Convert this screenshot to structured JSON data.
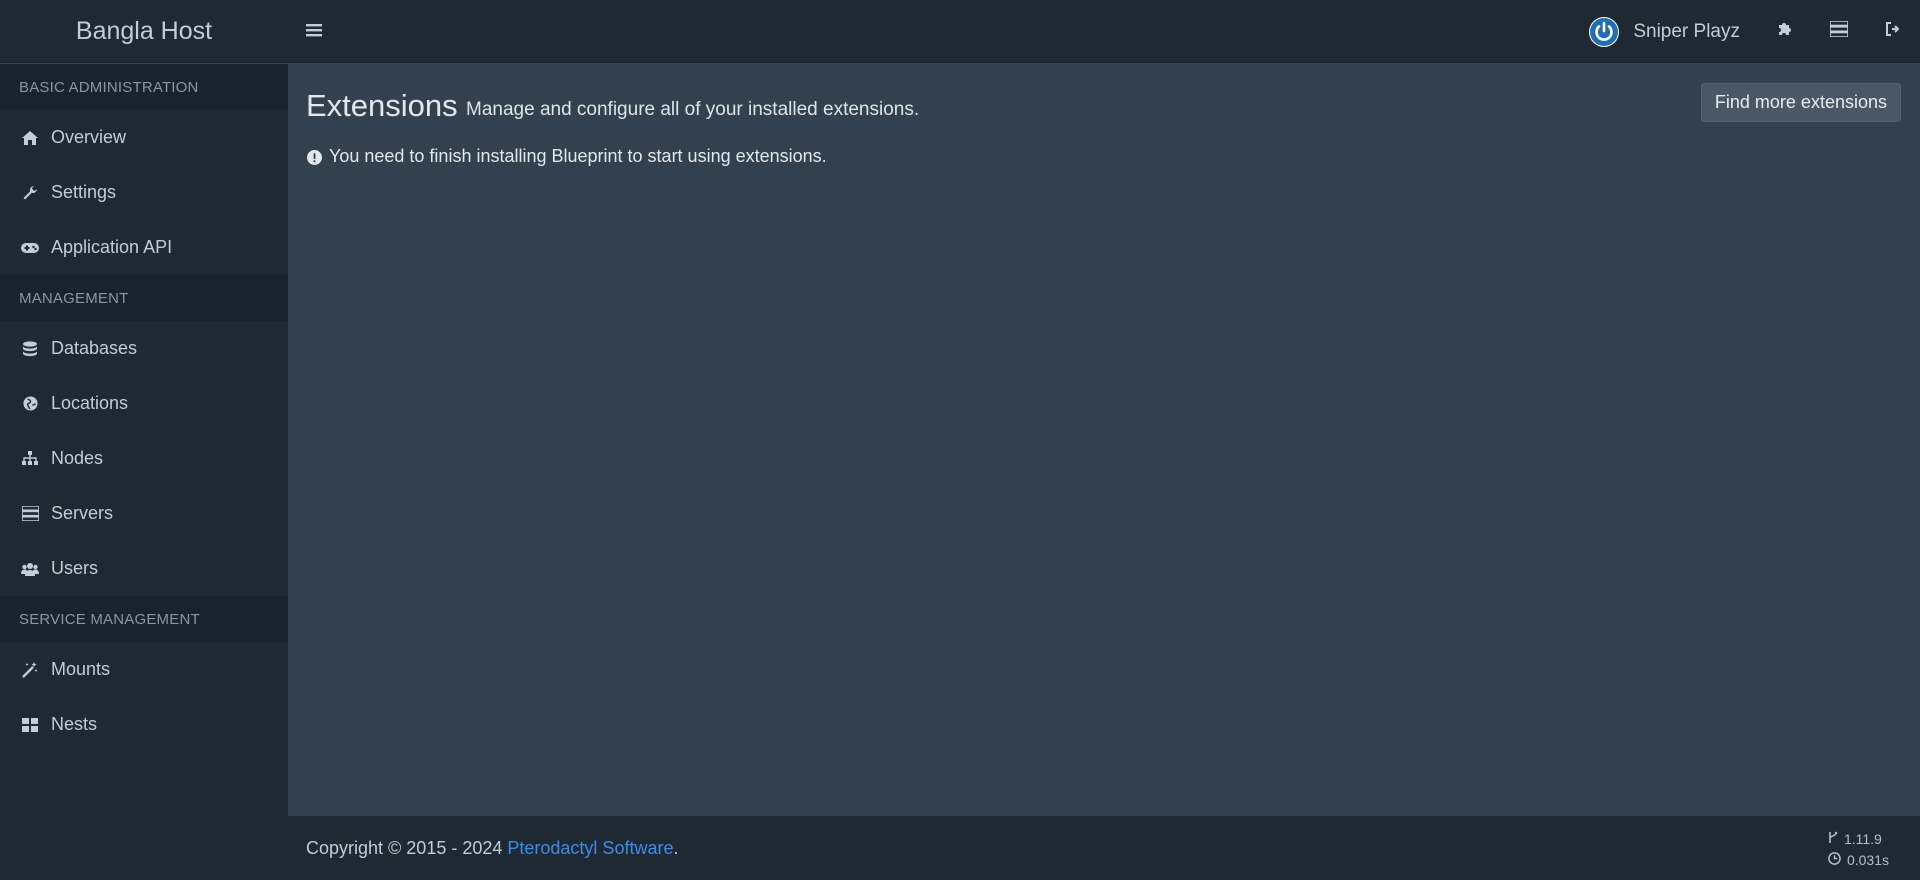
{
  "brand": {
    "title": "Bangla Host"
  },
  "user": {
    "name": "Sniper Playz"
  },
  "topbar_icons": [
    "puzzle-icon",
    "server-icon",
    "sign-out-icon"
  ],
  "sidebar": {
    "sections": [
      {
        "header": "BASIC ADMINISTRATION",
        "items": [
          {
            "label": "Overview",
            "icon": "home-icon"
          },
          {
            "label": "Settings",
            "icon": "wrench-icon"
          },
          {
            "label": "Application API",
            "icon": "gamepad-icon"
          }
        ]
      },
      {
        "header": "MANAGEMENT",
        "items": [
          {
            "label": "Databases",
            "icon": "database-icon"
          },
          {
            "label": "Locations",
            "icon": "globe-icon"
          },
          {
            "label": "Nodes",
            "icon": "sitemap-icon"
          },
          {
            "label": "Servers",
            "icon": "server-icon"
          },
          {
            "label": "Users",
            "icon": "users-icon"
          }
        ]
      },
      {
        "header": "SERVICE MANAGEMENT",
        "items": [
          {
            "label": "Mounts",
            "icon": "magic-icon"
          },
          {
            "label": "Nests",
            "icon": "th-large-icon"
          }
        ]
      }
    ]
  },
  "main": {
    "title": "Extensions",
    "subtitle": "Manage and configure all of your installed extensions.",
    "find_button": "Find more extensions",
    "notice": "You need to finish installing Blueprint to start using extensions."
  },
  "footer": {
    "copyright_prefix": "Copyright © 2015 - 2024 ",
    "link_text": "Pterodactyl Software",
    "copyright_suffix": ".",
    "version": "1.11.9",
    "time": "0.031s"
  },
  "colors": {
    "accent_link": "#3b8ee8",
    "avatar_blue": "#1f6fb8",
    "bg_content": "#33404d",
    "bg_sidebar": "#1f2933"
  }
}
